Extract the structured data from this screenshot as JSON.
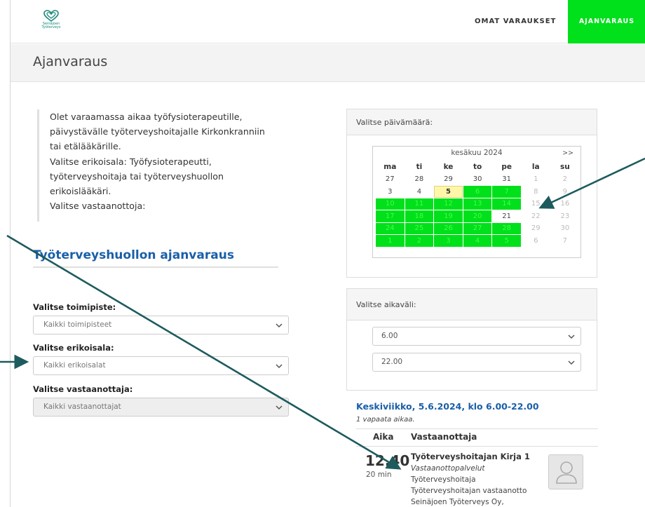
{
  "header": {
    "logo_text_1": "Seinäjoen",
    "logo_text_2": "Työterveys",
    "nav_omat": "OMAT VARAUKSET",
    "nav_ajan": "AJANVARAUS"
  },
  "page_title": "Ajanvaraus",
  "intro": {
    "lines": [
      "Olet varaamassa aikaa työfysioterapeutille,",
      "päivystävälle työterveyshoitajalle Kirkonkranniin",
      "tai etälääkärille.",
      "Valitse erikoisala: Työfysioterapeutti,",
      "työterveyshoitaja tai työterveyshuollon",
      "erikoislääkäri.",
      "Valitse vastaanottoja:"
    ]
  },
  "booking": {
    "title": "Työterveyshuollon ajanvaraus",
    "location_label": "Valitse toimipiste:",
    "location_value": "Kaikki toimipisteet",
    "specialty_label": "Valitse erikoisala:",
    "specialty_value": "Kaikki erikoisalat",
    "provider_label": "Valitse vastaanottaja:",
    "provider_value": "Kaikki vastaanottajat"
  },
  "date_panel": {
    "title": "Valitse päivämäärä:",
    "month": "kesäkuu 2024",
    "next": ">>",
    "weekdays": [
      "ma",
      "ti",
      "ke",
      "to",
      "pe",
      "la",
      "su"
    ],
    "weeks": [
      [
        [
          "27",
          "n"
        ],
        [
          "28",
          "n"
        ],
        [
          "29",
          "n"
        ],
        [
          "30",
          "n"
        ],
        [
          "31",
          "n"
        ],
        [
          "1",
          "m"
        ],
        [
          "2",
          "m"
        ]
      ],
      [
        [
          "3",
          "n"
        ],
        [
          "4",
          "n"
        ],
        [
          "5",
          "s"
        ],
        [
          "6",
          "g"
        ],
        [
          "7",
          "g"
        ],
        [
          "8",
          "m"
        ],
        [
          "9",
          "m"
        ]
      ],
      [
        [
          "10",
          "g"
        ],
        [
          "11",
          "g"
        ],
        [
          "12",
          "g"
        ],
        [
          "13",
          "g"
        ],
        [
          "14",
          "g"
        ],
        [
          "15",
          "m"
        ],
        [
          "16",
          "m"
        ]
      ],
      [
        [
          "17",
          "g"
        ],
        [
          "18",
          "g"
        ],
        [
          "19",
          "g"
        ],
        [
          "20",
          "g"
        ],
        [
          "21",
          "n"
        ],
        [
          "22",
          "m"
        ],
        [
          "23",
          "m"
        ]
      ],
      [
        [
          "24",
          "g"
        ],
        [
          "25",
          "g"
        ],
        [
          "26",
          "g"
        ],
        [
          "27",
          "g"
        ],
        [
          "28",
          "g"
        ],
        [
          "29",
          "m"
        ],
        [
          "30",
          "m"
        ]
      ],
      [
        [
          "1",
          "g"
        ],
        [
          "2",
          "g"
        ],
        [
          "3",
          "g"
        ],
        [
          "4",
          "g"
        ],
        [
          "5",
          "g"
        ],
        [
          "6",
          "m"
        ],
        [
          "7",
          "m"
        ]
      ]
    ]
  },
  "time_panel": {
    "title": "Valitse aikaväli:",
    "start": "6.00",
    "end": "22.00"
  },
  "results": {
    "heading": "Keskiviikko, 5.6.2024, klo 6.00-22.00",
    "count": "1 vapaata aikaa.",
    "col_time": "Aika",
    "col_provider": "Vastaanottaja",
    "time": "12.40",
    "duration": "20 min",
    "provider": "Työterveyshoitajan Kirja 1",
    "service": "Vastaanottopalvelut",
    "role": "Työterveyshoitaja",
    "type": "Työterveyshoitajan vastaanotto",
    "org": "Seinäjoen Työterveys Oy,"
  },
  "colors": {
    "green": "#00e01b",
    "blue": "#1a5fa8",
    "arrow": "#1d5b5e"
  }
}
